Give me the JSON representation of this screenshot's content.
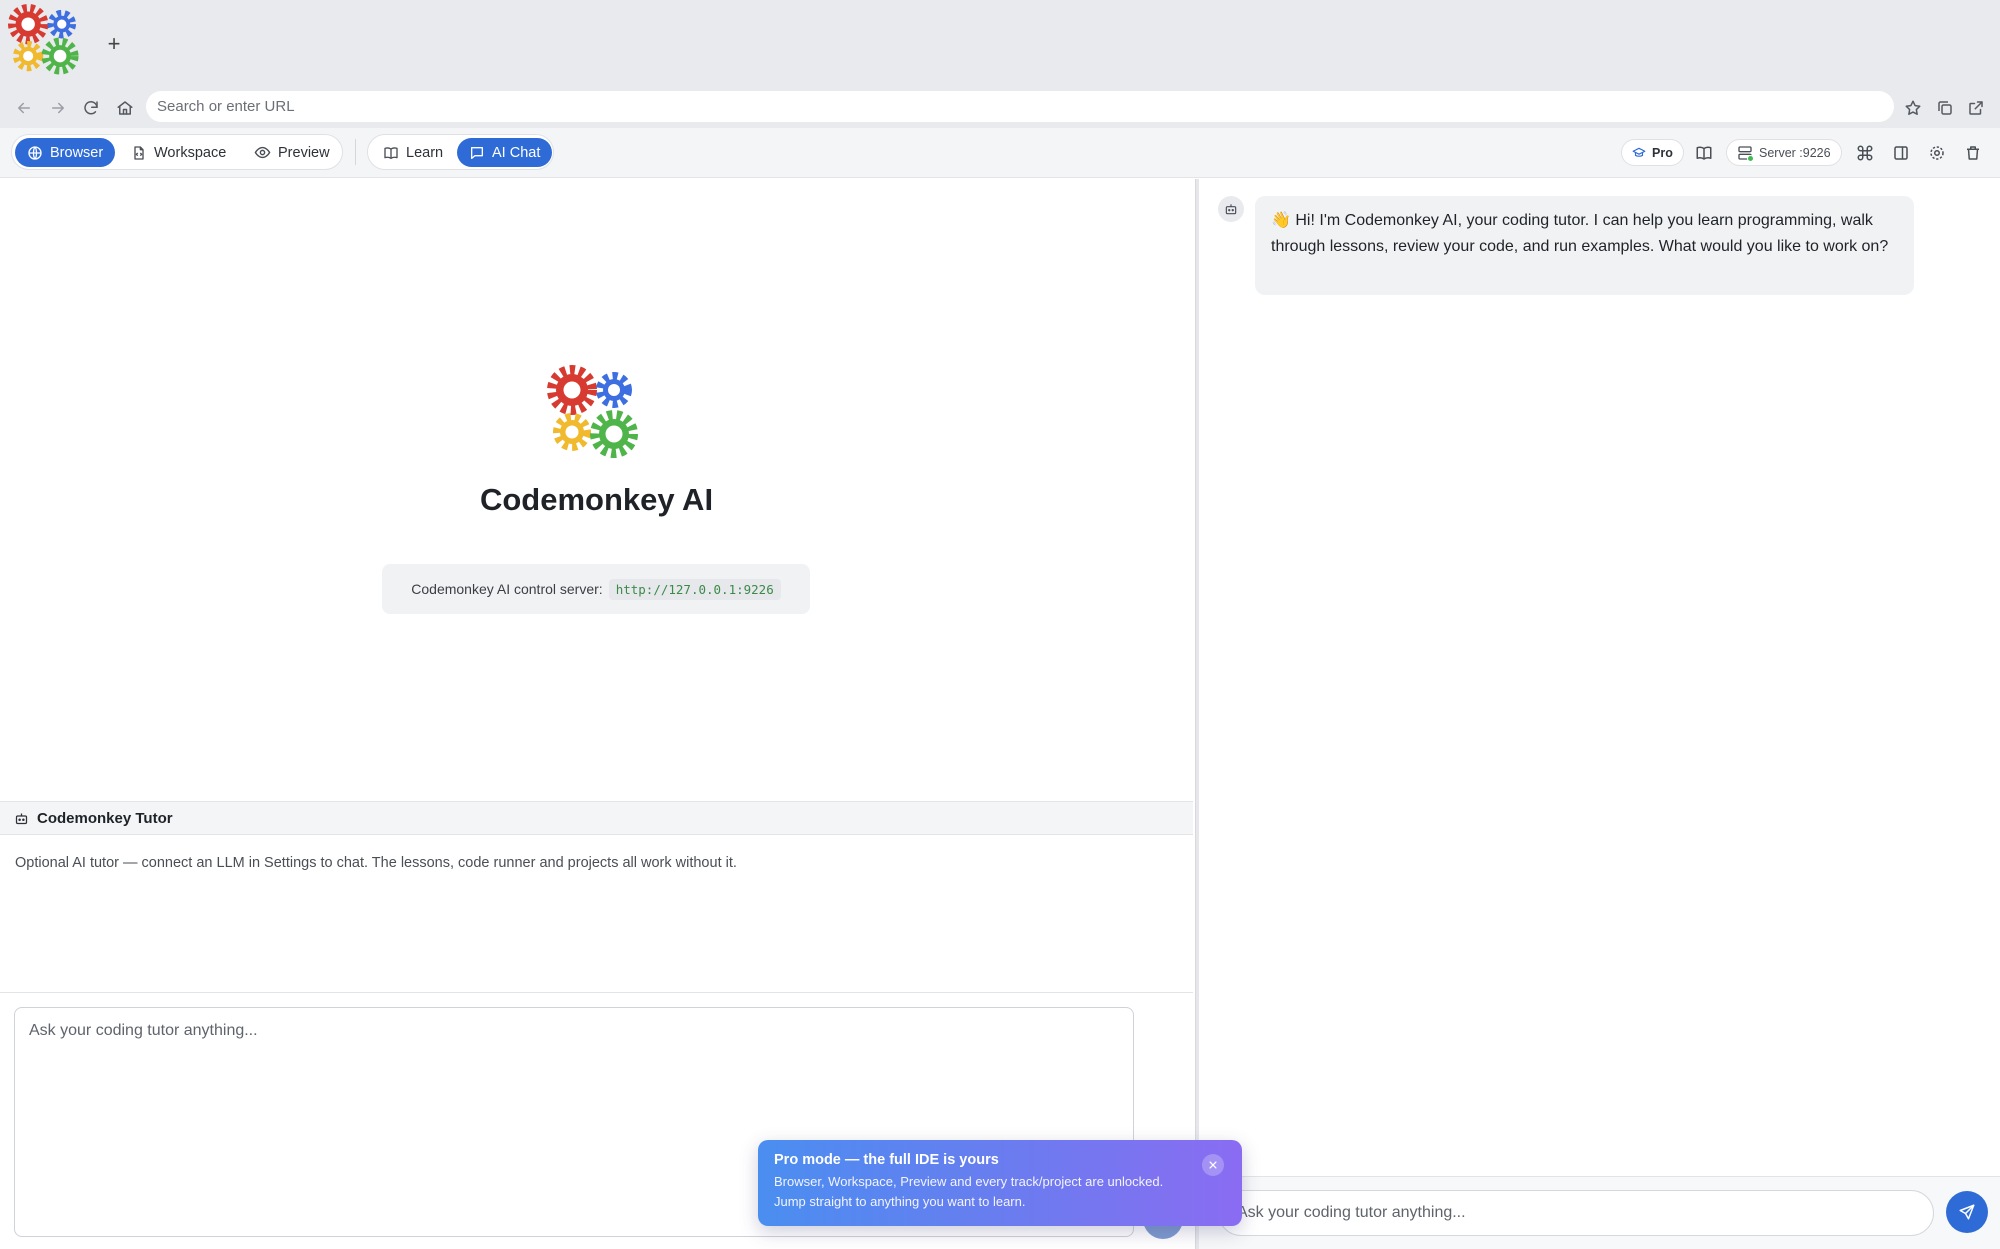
{
  "browser": {
    "new_tab_symbol": "+",
    "url_placeholder": "Search or enter URL"
  },
  "toolbar": {
    "modes": [
      {
        "label": "Browser",
        "icon": "globe-icon",
        "active": true
      },
      {
        "label": "Workspace",
        "icon": "code-file-icon",
        "active": false
      },
      {
        "label": "Preview",
        "icon": "eye-icon",
        "active": false
      }
    ],
    "panels": [
      {
        "label": "Learn",
        "icon": "book-icon",
        "active": false
      },
      {
        "label": "AI Chat",
        "icon": "chat-icon",
        "active": true
      }
    ],
    "pro_label": "Pro",
    "server_label": "Server :9226"
  },
  "hero": {
    "title": "Codemonkey AI",
    "server_text": "Codemonkey AI control server:",
    "server_url": "http://127.0.0.1:9226"
  },
  "tutor": {
    "title": "Codemonkey Tutor",
    "description": "Optional AI tutor — connect an LLM in Settings to chat. The lessons, code runner and projects all work without it.",
    "input_placeholder": "Ask your coding tutor anything..."
  },
  "chat": {
    "messages": [
      {
        "role": "assistant",
        "text": "👋 Hi! I'm Codemonkey AI, your coding tutor. I can help you learn programming, walk through lessons, review your code, and run examples. What would you like to work on?"
      }
    ],
    "input_placeholder": "Ask your coding tutor anything..."
  },
  "toast": {
    "title": "Pro mode — the full IDE is yours",
    "body": "Browser, Workspace, Preview and every track/project are unlocked. Jump straight to anything you want to learn."
  },
  "colors": {
    "accent": "#2f6bd6",
    "gear_red": "#d63a30",
    "gear_blue": "#3d6fe0",
    "gear_yellow": "#f0b92e",
    "gear_green": "#4fb449"
  }
}
